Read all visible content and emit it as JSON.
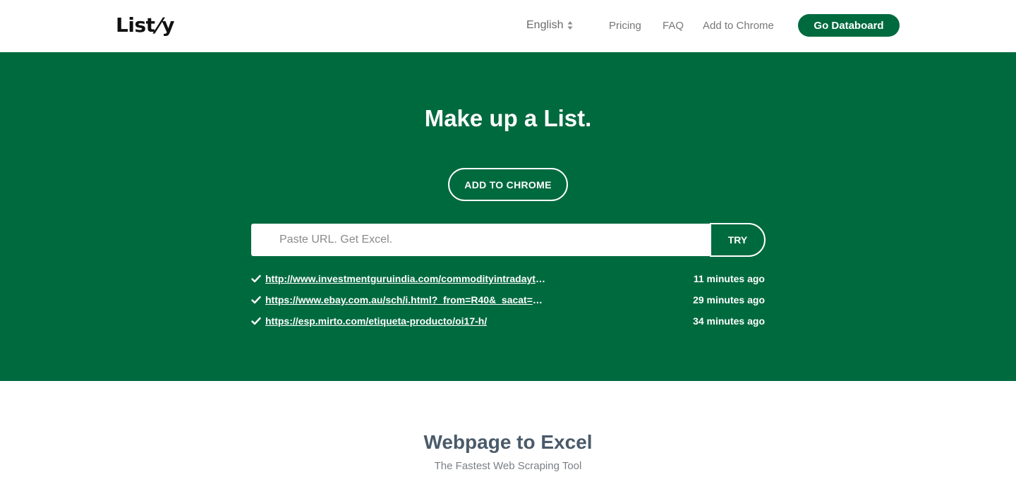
{
  "header": {
    "logo": "Listly",
    "logo_prefix": "List",
    "logo_slash": "/",
    "logo_suffix": "y",
    "language": "English",
    "nav": {
      "pricing": "Pricing",
      "faq": "FAQ",
      "add_to_chrome": "Add to Chrome"
    },
    "cta": "Go Databoard"
  },
  "hero": {
    "title": "Make up a List.",
    "chrome_button": "ADD TO CHROME",
    "search": {
      "placeholder": "Paste URL. Get Excel.",
      "value": ""
    },
    "try_button": "TRY",
    "history": [
      {
        "url": "http://www.investmentguruindia.com/commodityintradaytip…",
        "time": "11 minutes ago"
      },
      {
        "url": "https://www.ebay.com.au/sch/i.html?_from=R40&_sacat=0…",
        "time": "29 minutes ago"
      },
      {
        "url": "https://esp.mirto.com/etiqueta-producto/oi17-h/",
        "time": "34 minutes ago"
      }
    ]
  },
  "section": {
    "title": "Webpage to Excel",
    "subtitle": "The Fastest Web Scraping Tool"
  },
  "colors": {
    "brand": "#006a3f",
    "heading": "#4a5a6a"
  },
  "icons": {
    "language_sort": "sort-icon",
    "history_check": "check-icon"
  }
}
